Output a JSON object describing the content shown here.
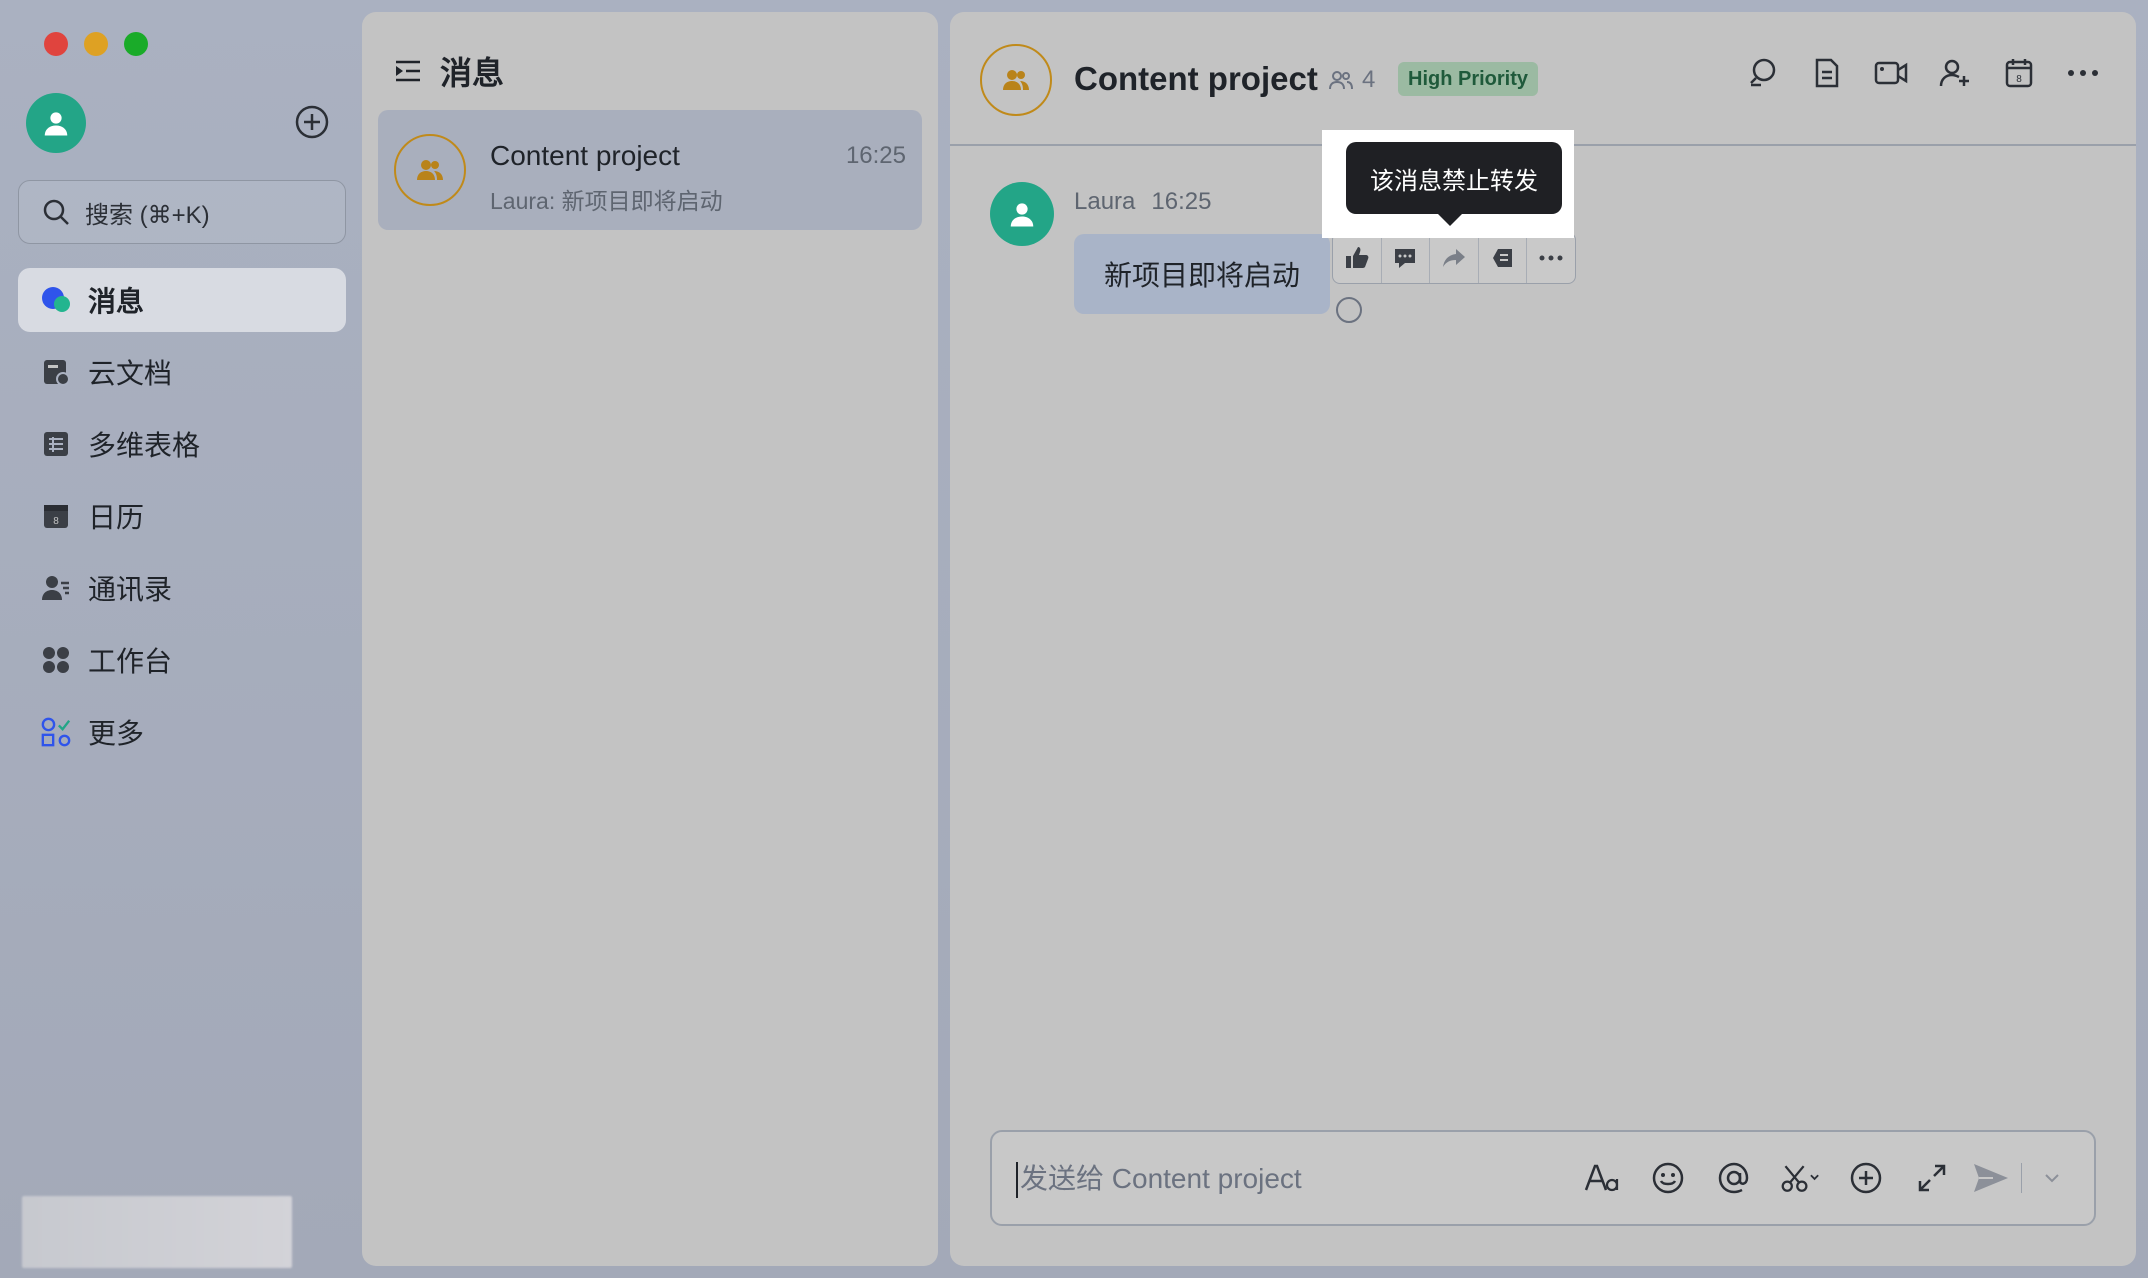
{
  "sidebar": {
    "search_placeholder": "搜索 (⌘+K)",
    "items": [
      {
        "label": "消息",
        "icon": "message-icon",
        "active": true
      },
      {
        "label": "云文档",
        "icon": "docs-icon"
      },
      {
        "label": "多维表格",
        "icon": "base-table-icon"
      },
      {
        "label": "日历",
        "icon": "calendar-icon"
      },
      {
        "label": "通讯录",
        "icon": "contacts-icon"
      },
      {
        "label": "工作台",
        "icon": "workplace-icon"
      },
      {
        "label": "更多",
        "icon": "more-apps-icon"
      }
    ]
  },
  "list": {
    "title": "消息",
    "conversations": [
      {
        "name": "Content project",
        "time": "16:25",
        "preview": "Laura: 新项目即将启动"
      }
    ]
  },
  "chat": {
    "title": "Content project",
    "member_count": "4",
    "priority_tag": "High Priority",
    "messages": [
      {
        "sender": "Laura",
        "time": "16:25",
        "text": "新项目即将启动"
      }
    ],
    "tooltip": "该消息禁止转发",
    "composer_placeholder": "发送给 Content project"
  },
  "colors": {
    "accent_green": "#23a587",
    "group_avatar_border": "#c08a1a",
    "priority_tag_bg": "#9bbaa2"
  }
}
